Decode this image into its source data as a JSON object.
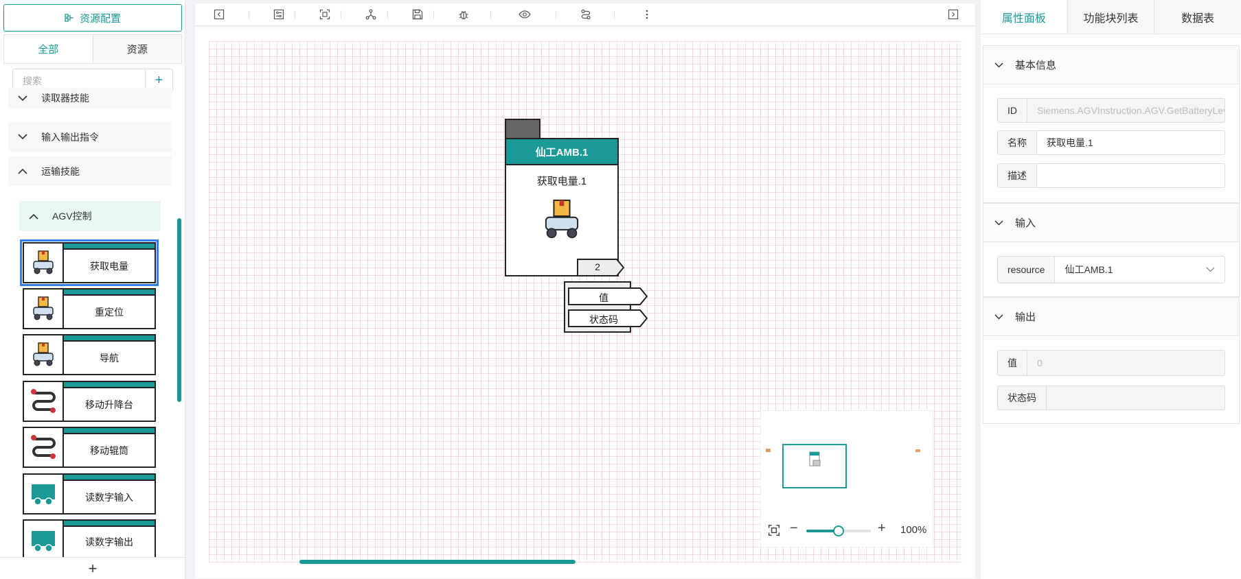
{
  "left": {
    "resource_button": "资源配置",
    "tabs": [
      "全部",
      "资源"
    ],
    "search_placeholder": "搜索",
    "categories": [
      "读取器技能",
      "输入输出指令",
      "运输技能"
    ],
    "subcategory": "AGV控制",
    "items": [
      {
        "label": "获取电量",
        "icon": "agv-robot-icon"
      },
      {
        "label": "重定位",
        "icon": "agv-robot-icon"
      },
      {
        "label": "导航",
        "icon": "agv-robot-icon"
      },
      {
        "label": "移动升降台",
        "icon": "route-path-icon"
      },
      {
        "label": "移动辊筒",
        "icon": "route-path-icon"
      },
      {
        "label": "读数字输入",
        "icon": "cart-icon"
      },
      {
        "label": "读数字输出",
        "icon": "cart-icon"
      }
    ]
  },
  "toolbar": {
    "icons": [
      "collapse-left-icon",
      "settings-sliders-icon",
      "fit-frame-icon",
      "share-nodes-icon",
      "save-icon",
      "debug-bug-icon",
      "preview-eye-icon",
      "flow-link-icon",
      "more-vertical-icon",
      "collapse-right-icon"
    ]
  },
  "node": {
    "header": "仙工AMB.1",
    "name": "获取电量.1",
    "port_count": "2",
    "outputs": [
      "值",
      "状态码"
    ]
  },
  "zoom": {
    "level": "100%",
    "slider_fraction": 0.5
  },
  "right": {
    "tabs": [
      "属性面板",
      "功能块列表",
      "数据表"
    ],
    "basic": {
      "title": "基本信息",
      "id_label": "ID",
      "id_value": "Siemens.AGVInstruction.AGV.GetBatteryLeve",
      "name_label": "名称",
      "name_value": "获取电量.1",
      "desc_label": "描述",
      "desc_value": ""
    },
    "input": {
      "title": "输入",
      "resource_label": "resource",
      "resource_value": "仙工AMB.1"
    },
    "output": {
      "title": "输出",
      "value_label": "值",
      "value_value": "0",
      "status_label": "状态码",
      "status_value": ""
    }
  },
  "colors": {
    "accent": "#1a9a96",
    "selection": "#2f80ed",
    "grid": "#f3d9df"
  }
}
